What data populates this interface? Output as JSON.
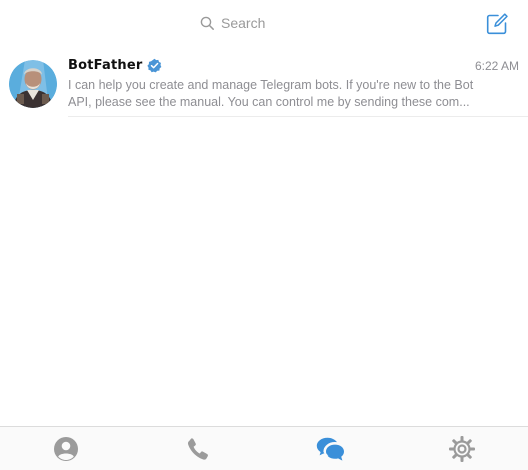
{
  "search": {
    "placeholder": "Search"
  },
  "chats": [
    {
      "name": "BotFather",
      "verified": true,
      "time": "6:22 AM",
      "preview_line1": "I can help you create and manage Telegram bots. If you're new to the Bot",
      "preview_line2": "API, please see the manual.  You can control me by sending these com..."
    }
  ],
  "tabs": [
    {
      "id": "contacts",
      "icon": "contacts-icon",
      "active": false
    },
    {
      "id": "calls",
      "icon": "phone-icon",
      "active": false
    },
    {
      "id": "chats",
      "icon": "chats-icon",
      "active": true
    },
    {
      "id": "settings",
      "icon": "gear-icon",
      "active": false
    }
  ],
  "colors": {
    "accent": "#3a8fd9",
    "inactive_icon": "#9b9b9b",
    "verified": "#4a95d6"
  }
}
